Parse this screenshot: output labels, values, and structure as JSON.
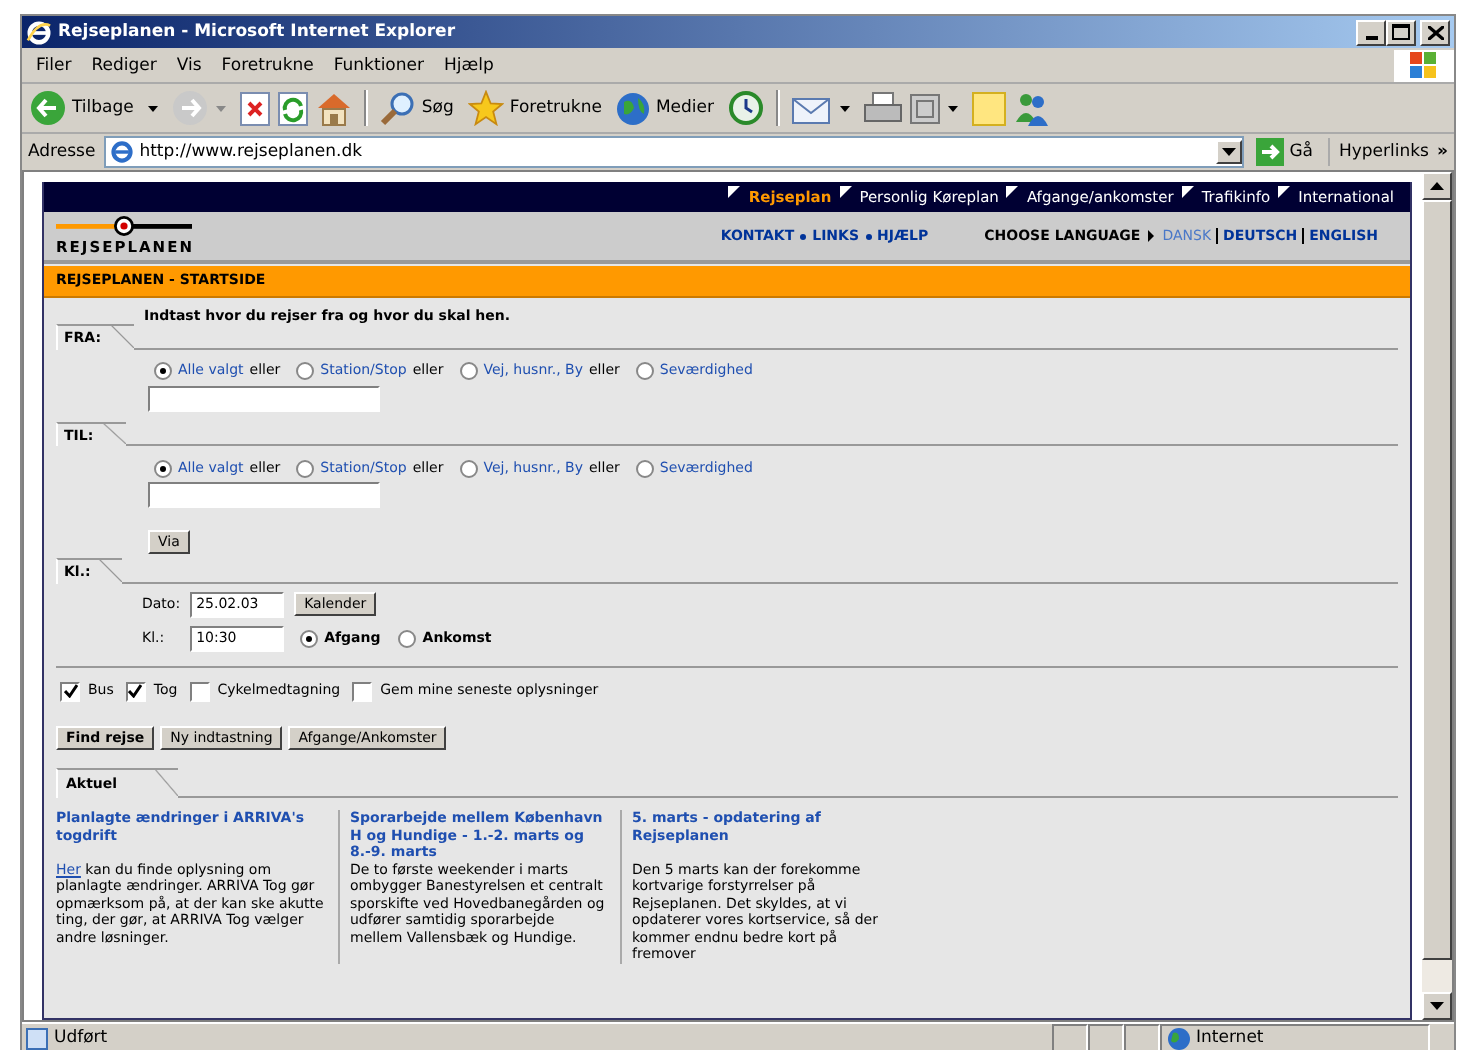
{
  "window": {
    "title": "Rejseplanen - Microsoft Internet Explorer"
  },
  "menu": [
    "Filer",
    "Rediger",
    "Vis",
    "Foretrukne",
    "Funktioner",
    "Hjælp"
  ],
  "toolbar": {
    "back": "Tilbage",
    "search": "Søg",
    "favorites": "Foretrukne",
    "media": "Medier"
  },
  "address": {
    "label": "Adresse",
    "value": "http://www.rejseplanen.dk",
    "go": "Gå",
    "links": "Hyperlinks",
    "more": "»"
  },
  "site": {
    "nav": [
      {
        "label": "Rejseplan",
        "selected": true
      },
      {
        "label": "Personlig Køreplan",
        "selected": false
      },
      {
        "label": "Afgange/ankomster",
        "selected": false
      },
      {
        "label": "Trafikinfo",
        "selected": false
      },
      {
        "label": "International",
        "selected": false
      }
    ],
    "logo": "REJSEPLANEN",
    "links": [
      "KONTAKT",
      "LINKS",
      "HJÆLP"
    ],
    "language_label": "CHOOSE LANGUAGE",
    "languages": [
      {
        "label": "DANSK",
        "selected": true
      },
      {
        "label": "DEUTSCH",
        "selected": false
      },
      {
        "label": "ENGLISH",
        "selected": false
      }
    ],
    "breadcrumb": "REJSEPLANEN - STARTSIDE",
    "intro": "Indtast hvor du rejser fra og hvor du skal hen.",
    "places": [
      {
        "label": "FRA:",
        "options": [
          {
            "label": "Alle valgt",
            "connector": "eller",
            "selected": true
          },
          {
            "label": "Station/Stop",
            "connector": "eller",
            "selected": false
          },
          {
            "label": "Vej, husnr., By",
            "connector": "eller",
            "selected": false
          },
          {
            "label": "Seværdighed",
            "selected": false
          }
        ]
      },
      {
        "label": "TIL:",
        "options": [
          {
            "label": "Alle valgt",
            "connector": "eller",
            "selected": true
          },
          {
            "label": "Station/Stop",
            "connector": "eller",
            "selected": false
          },
          {
            "label": "Vej, husnr., By",
            "connector": "eller",
            "selected": false
          },
          {
            "label": "Seværdighed",
            "selected": false
          }
        ]
      }
    ],
    "via": "Via",
    "time": {
      "label": "Kl.:",
      "date_label": "Dato:",
      "date": "25.02.03",
      "calendar": "Kalender",
      "time_label": "Kl.:",
      "time": "10:30",
      "modes": [
        {
          "label": "Afgang",
          "selected": true
        },
        {
          "label": "Ankomst",
          "selected": false
        }
      ]
    },
    "options": [
      {
        "label": "Bus",
        "checked": true
      },
      {
        "label": "Tog",
        "checked": true
      },
      {
        "label": "Cykelmedtagning",
        "checked": false
      },
      {
        "label": "Gem mine seneste oplysninger",
        "checked": false
      }
    ],
    "buttons": [
      {
        "label": "Find rejse",
        "kind": "primary"
      },
      {
        "label": "Ny indtastning",
        "kind": "normal"
      },
      {
        "label": "Afgange/Ankomster",
        "kind": "normal"
      }
    ],
    "news_tab": "Aktuel",
    "news": [
      {
        "title": "Planlagte ændringer i ARRIVA's togdrift",
        "link": "Her",
        "body": " kan du finde oplysning om planlagte ændringer. ARRIVA Tog gør opmærksom på, at der kan ske akutte ting, der gør, at ARRIVA Tog vælger andre løsninger."
      },
      {
        "title": "Sporarbejde mellem København H og Hundige - 1.-2. marts og 8.-9. marts",
        "body": "De to første weekender i marts ombygger Banestyrelsen et centralt sporskifte ved Hovedbanegården og udfører samtidig sporarbejde mellem Vallensbæk og Hundige."
      },
      {
        "title": "5. marts - opdatering af Rejseplanen",
        "body": "Den 5 marts kan der forekomme kortvarige forstyrrelser på Rejseplanen. Det skyldes, at vi opdaterer vores kortservice, så der kommer endnu bedre kort på fremover"
      }
    ]
  },
  "status": {
    "text": "Udført",
    "zone": "Internet"
  }
}
